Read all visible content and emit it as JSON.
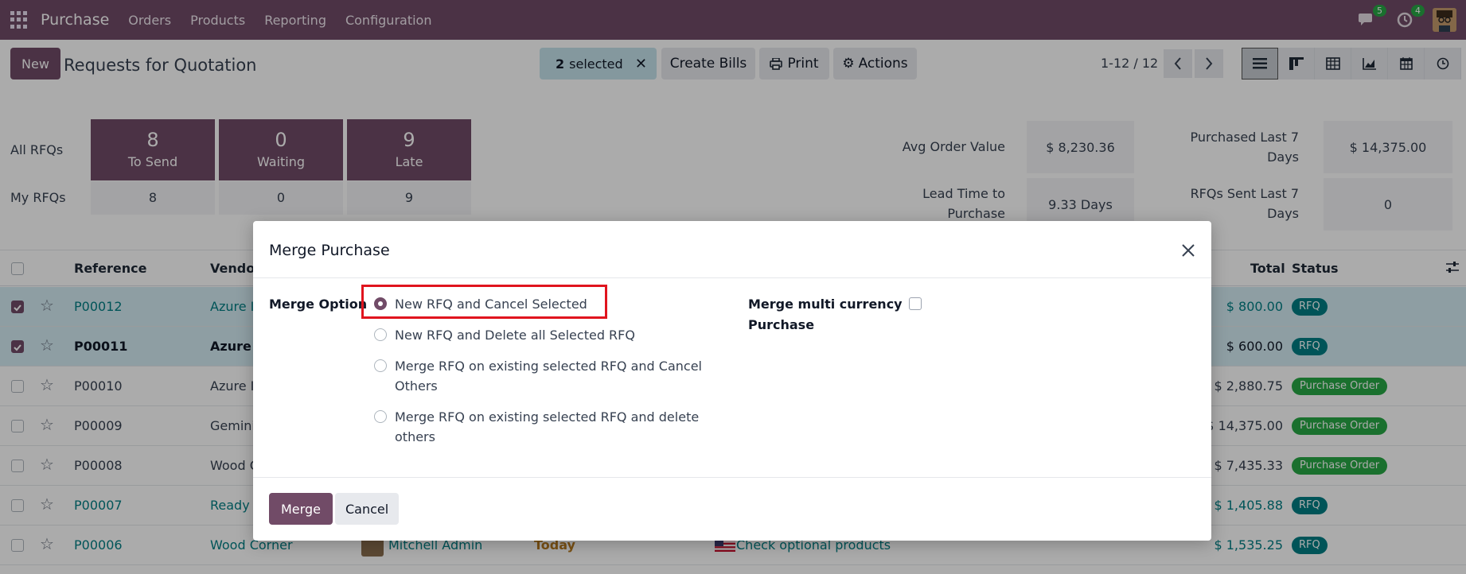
{
  "navbar": {
    "app_name": "Purchase",
    "menu": [
      "Orders",
      "Products",
      "Reporting",
      "Configuration"
    ],
    "messages_count": "5",
    "activities_count": "4"
  },
  "control_panel": {
    "new_label": "New",
    "title": "Requests for Quotation",
    "selected_count": "2",
    "selected_label": "selected",
    "create_bills_label": "Create Bills",
    "print_label": "Print",
    "actions_label": "Actions",
    "pager": "1-12 / 12",
    "views": [
      "list-view-icon",
      "kanban-view-icon",
      "pivot-view-icon",
      "graph-view-icon",
      "calendar-view-icon",
      "activity-view-icon"
    ]
  },
  "dashboard": {
    "all_rfqs_label": "All RFQs",
    "my_rfqs_label": "My RFQs",
    "tiles": [
      {
        "num": "8",
        "label": "To Send",
        "mine": "8"
      },
      {
        "num": "0",
        "label": "Waiting",
        "mine": "0"
      },
      {
        "num": "9",
        "label": "Late",
        "mine": "9"
      }
    ],
    "avg_order_value_label": "Avg Order Value",
    "avg_order_value": "$ 8,230.36",
    "purchased_last_7_label_1": "Purchased Last 7",
    "purchased_last_7_label_2": "Days",
    "purchased_last_7": "$ 14,375.00",
    "lead_time_label_1": "Lead Time to",
    "lead_time_label_2": "Purchase",
    "lead_time": "9.33 Days",
    "rfqs_sent_label_1": "RFQs Sent Last 7",
    "rfqs_sent_label_2": "Days",
    "rfqs_sent": "0"
  },
  "list": {
    "columns": {
      "reference": "Reference",
      "vendor": "Vendor",
      "total": "Total",
      "status": "Status"
    },
    "rows": [
      {
        "ref": "P00012",
        "vendor": "Azure I",
        "total": "$ 800.00",
        "status": "RFQ",
        "selected": true
      },
      {
        "ref": "P00011",
        "vendor": "Azure I",
        "total": "$ 600.00",
        "status": "RFQ",
        "selected": true
      },
      {
        "ref": "P00010",
        "vendor": "Azure I",
        "total": "$ 2,880.75",
        "status": "Purchase Order",
        "selected": false
      },
      {
        "ref": "P00009",
        "vendor": "Gemini",
        "total": "$ 14,375.00",
        "status": "Purchase Order",
        "selected": false
      },
      {
        "ref": "P00008",
        "vendor": "Wood C",
        "total": "$ 7,435.33",
        "status": "Purchase Order",
        "selected": false
      },
      {
        "ref": "P00007",
        "vendor": "Ready I",
        "total": "$ 1,405.88",
        "status": "RFQ",
        "selected": false
      },
      {
        "ref": "P00006",
        "vendor": "Wood Corner",
        "buyer": "Mitchell Admin",
        "deadline": "Today",
        "activity": "Check optional products",
        "total": "$ 1,535.25",
        "status": "RFQ",
        "selected": false
      }
    ]
  },
  "modal": {
    "title": "Merge Purchase",
    "merge_option_label": "Merge Option",
    "options": [
      {
        "label": "New RFQ and Cancel Selected",
        "checked": true
      },
      {
        "label": "New RFQ and Delete all Selected RFQ",
        "checked": false
      },
      {
        "label_1": "Merge RFQ on existing selected RFQ and Cancel",
        "label_2": "Others",
        "checked": false
      },
      {
        "label_1": "Merge RFQ on existing selected RFQ and delete",
        "label_2": "others",
        "checked": false
      }
    ],
    "multi_currency_label_1": "Merge multi currency",
    "multi_currency_label_2": "Purchase",
    "multi_currency_checked": false,
    "merge_button": "Merge",
    "cancel_button": "Cancel"
  }
}
